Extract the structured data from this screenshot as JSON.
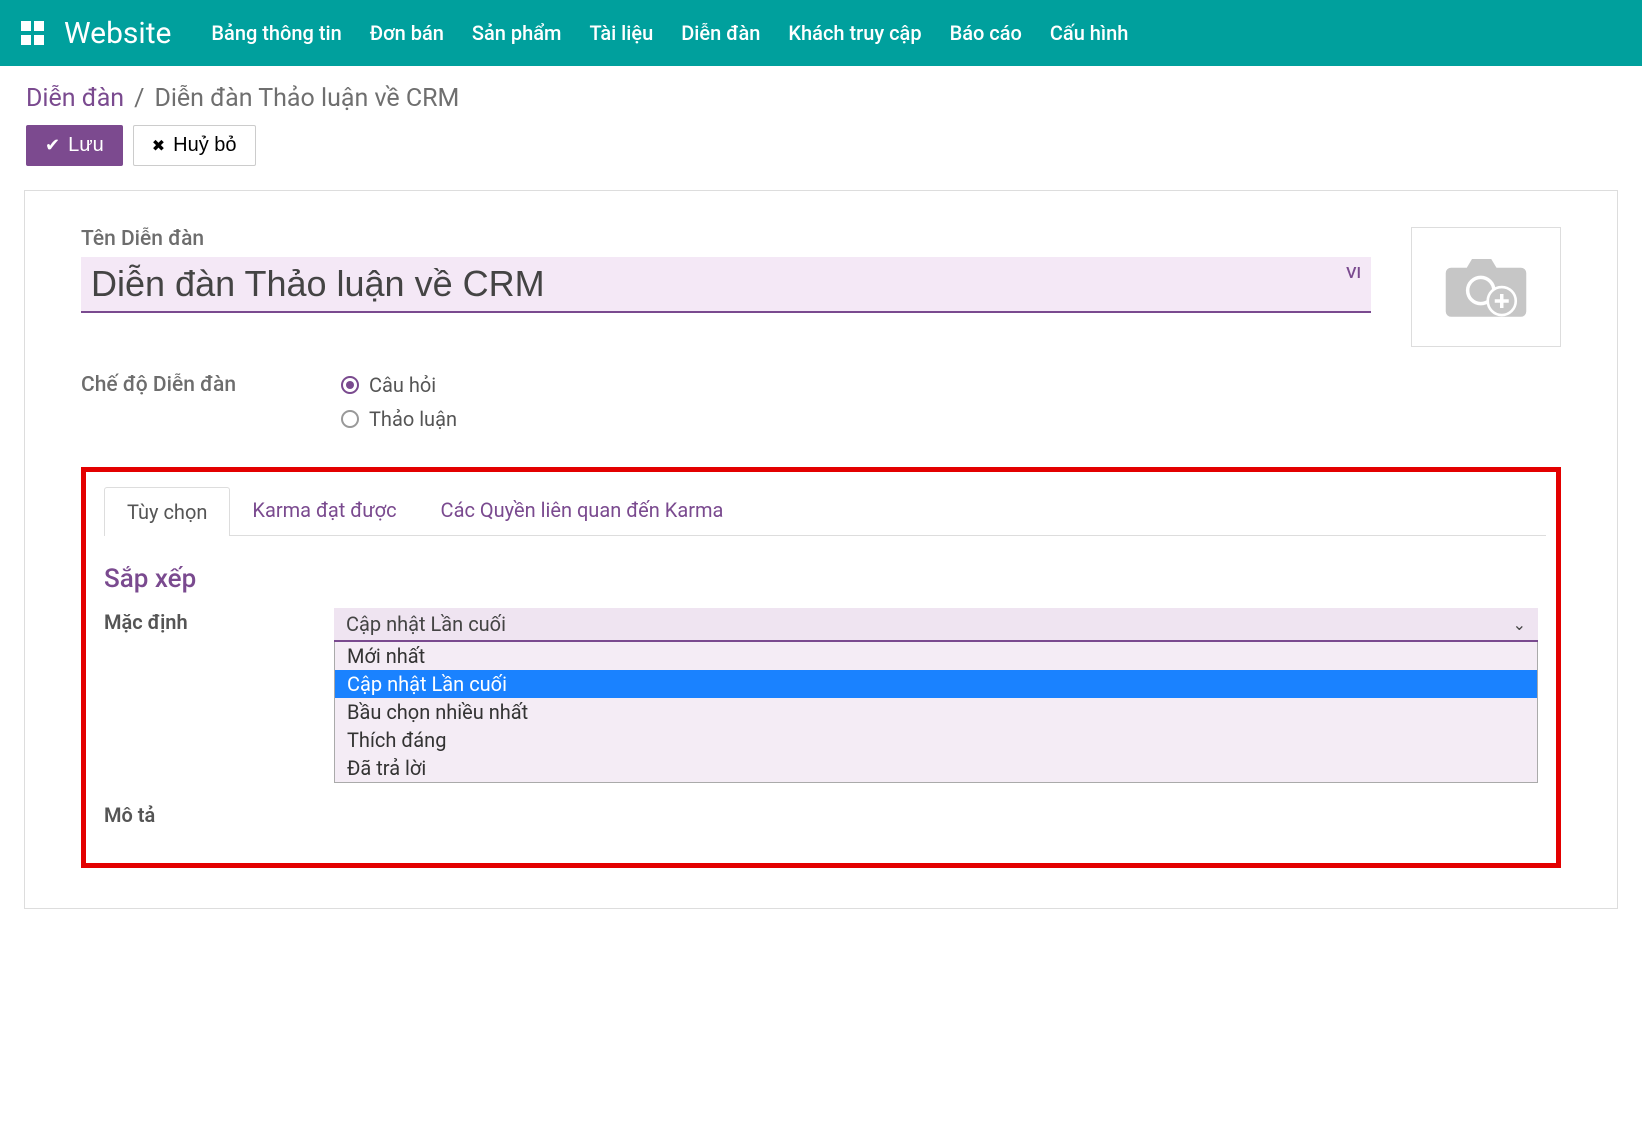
{
  "topnav": {
    "brand": "Website",
    "items": [
      "Bảng thông tin",
      "Đơn bán",
      "Sản phẩm",
      "Tài liệu",
      "Diễn đàn",
      "Khách truy cập",
      "Báo cáo",
      "Cấu hình"
    ]
  },
  "breadcrumb": {
    "root": "Diễn đàn",
    "sep": "/",
    "current": "Diễn đàn Thảo luận về CRM"
  },
  "buttons": {
    "save": "Lưu",
    "discard": "Huỷ bỏ"
  },
  "form": {
    "name_label": "Tên Diễn đàn",
    "name_value": "Diễn đàn Thảo luận về CRM",
    "lang_badge": "VI",
    "mode_label": "Chế độ Diễn đàn",
    "mode_options": [
      {
        "label": "Câu hỏi",
        "checked": true
      },
      {
        "label": "Thảo luận",
        "checked": false
      }
    ]
  },
  "tabs": {
    "items": [
      {
        "label": "Tùy chọn",
        "active": true
      },
      {
        "label": "Karma đạt được",
        "active": false
      },
      {
        "label": "Các Quyền liên quan đến Karma",
        "active": false
      }
    ]
  },
  "options": {
    "section_title": "Sắp xếp",
    "default_label": "Mặc định",
    "default_value": "Cập nhật Lần cuối",
    "dropdown_items": [
      {
        "label": "Mới nhất",
        "selected": false
      },
      {
        "label": "Cập nhật Lần cuối",
        "selected": true
      },
      {
        "label": "Bầu chọn nhiều nhất",
        "selected": false
      },
      {
        "label": "Thích đáng",
        "selected": false
      },
      {
        "label": "Đã trả lời",
        "selected": false
      }
    ],
    "desc_label": "Mô tả"
  }
}
